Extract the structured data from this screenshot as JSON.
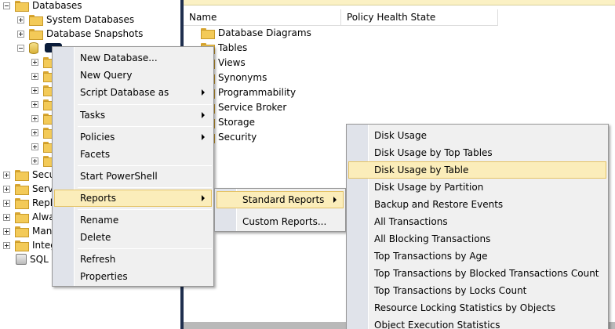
{
  "object_explorer": {
    "databases_label": "Databases",
    "system_databases_label": "System Databases",
    "database_snapshots_label": "Database Snapshots",
    "server_nodes": [
      {
        "label": "Secu"
      },
      {
        "label": "Serve"
      },
      {
        "label": "Repli"
      },
      {
        "label": "Alwa"
      },
      {
        "label": "Mana"
      },
      {
        "label": "Integ"
      },
      {
        "label": "SQL"
      }
    ]
  },
  "details_pane": {
    "columns": [
      "Name",
      "Policy Health State"
    ],
    "items": [
      "Database Diagrams",
      "Tables",
      "Views",
      "Synonyms",
      "Programmability",
      "Service Broker",
      "Storage",
      "Security"
    ]
  },
  "context_menu": {
    "new_database": "New Database...",
    "new_query": "New Query",
    "script_database_as": "Script Database as",
    "tasks": "Tasks",
    "policies": "Policies",
    "facets": "Facets",
    "start_powershell": "Start PowerShell",
    "reports": "Reports",
    "rename": "Rename",
    "delete": "Delete",
    "refresh": "Refresh",
    "properties": "Properties"
  },
  "reports_submenu": {
    "standard_reports": "Standard Reports",
    "custom_reports": "Custom Reports..."
  },
  "standard_reports_submenu": {
    "items": [
      "Disk Usage",
      "Disk Usage by Top Tables",
      "Disk Usage by Table",
      "Disk Usage by Partition",
      "Backup and Restore Events",
      "All Transactions",
      "All Blocking Transactions",
      "Top Transactions by Age",
      "Top Transactions by Blocked Transactions Count",
      "Top Transactions by Locks Count",
      "Resource Locking Statistics by Objects",
      "Object Execution Statistics"
    ],
    "highlighted": "Disk Usage by Table"
  },
  "colors": {
    "highlight_fill": "#fbedba",
    "highlight_border": "#e5c365",
    "menu_background": "#f0f0f0",
    "gutter": "#e0e3ea",
    "splitter": "#1f2f4e"
  }
}
